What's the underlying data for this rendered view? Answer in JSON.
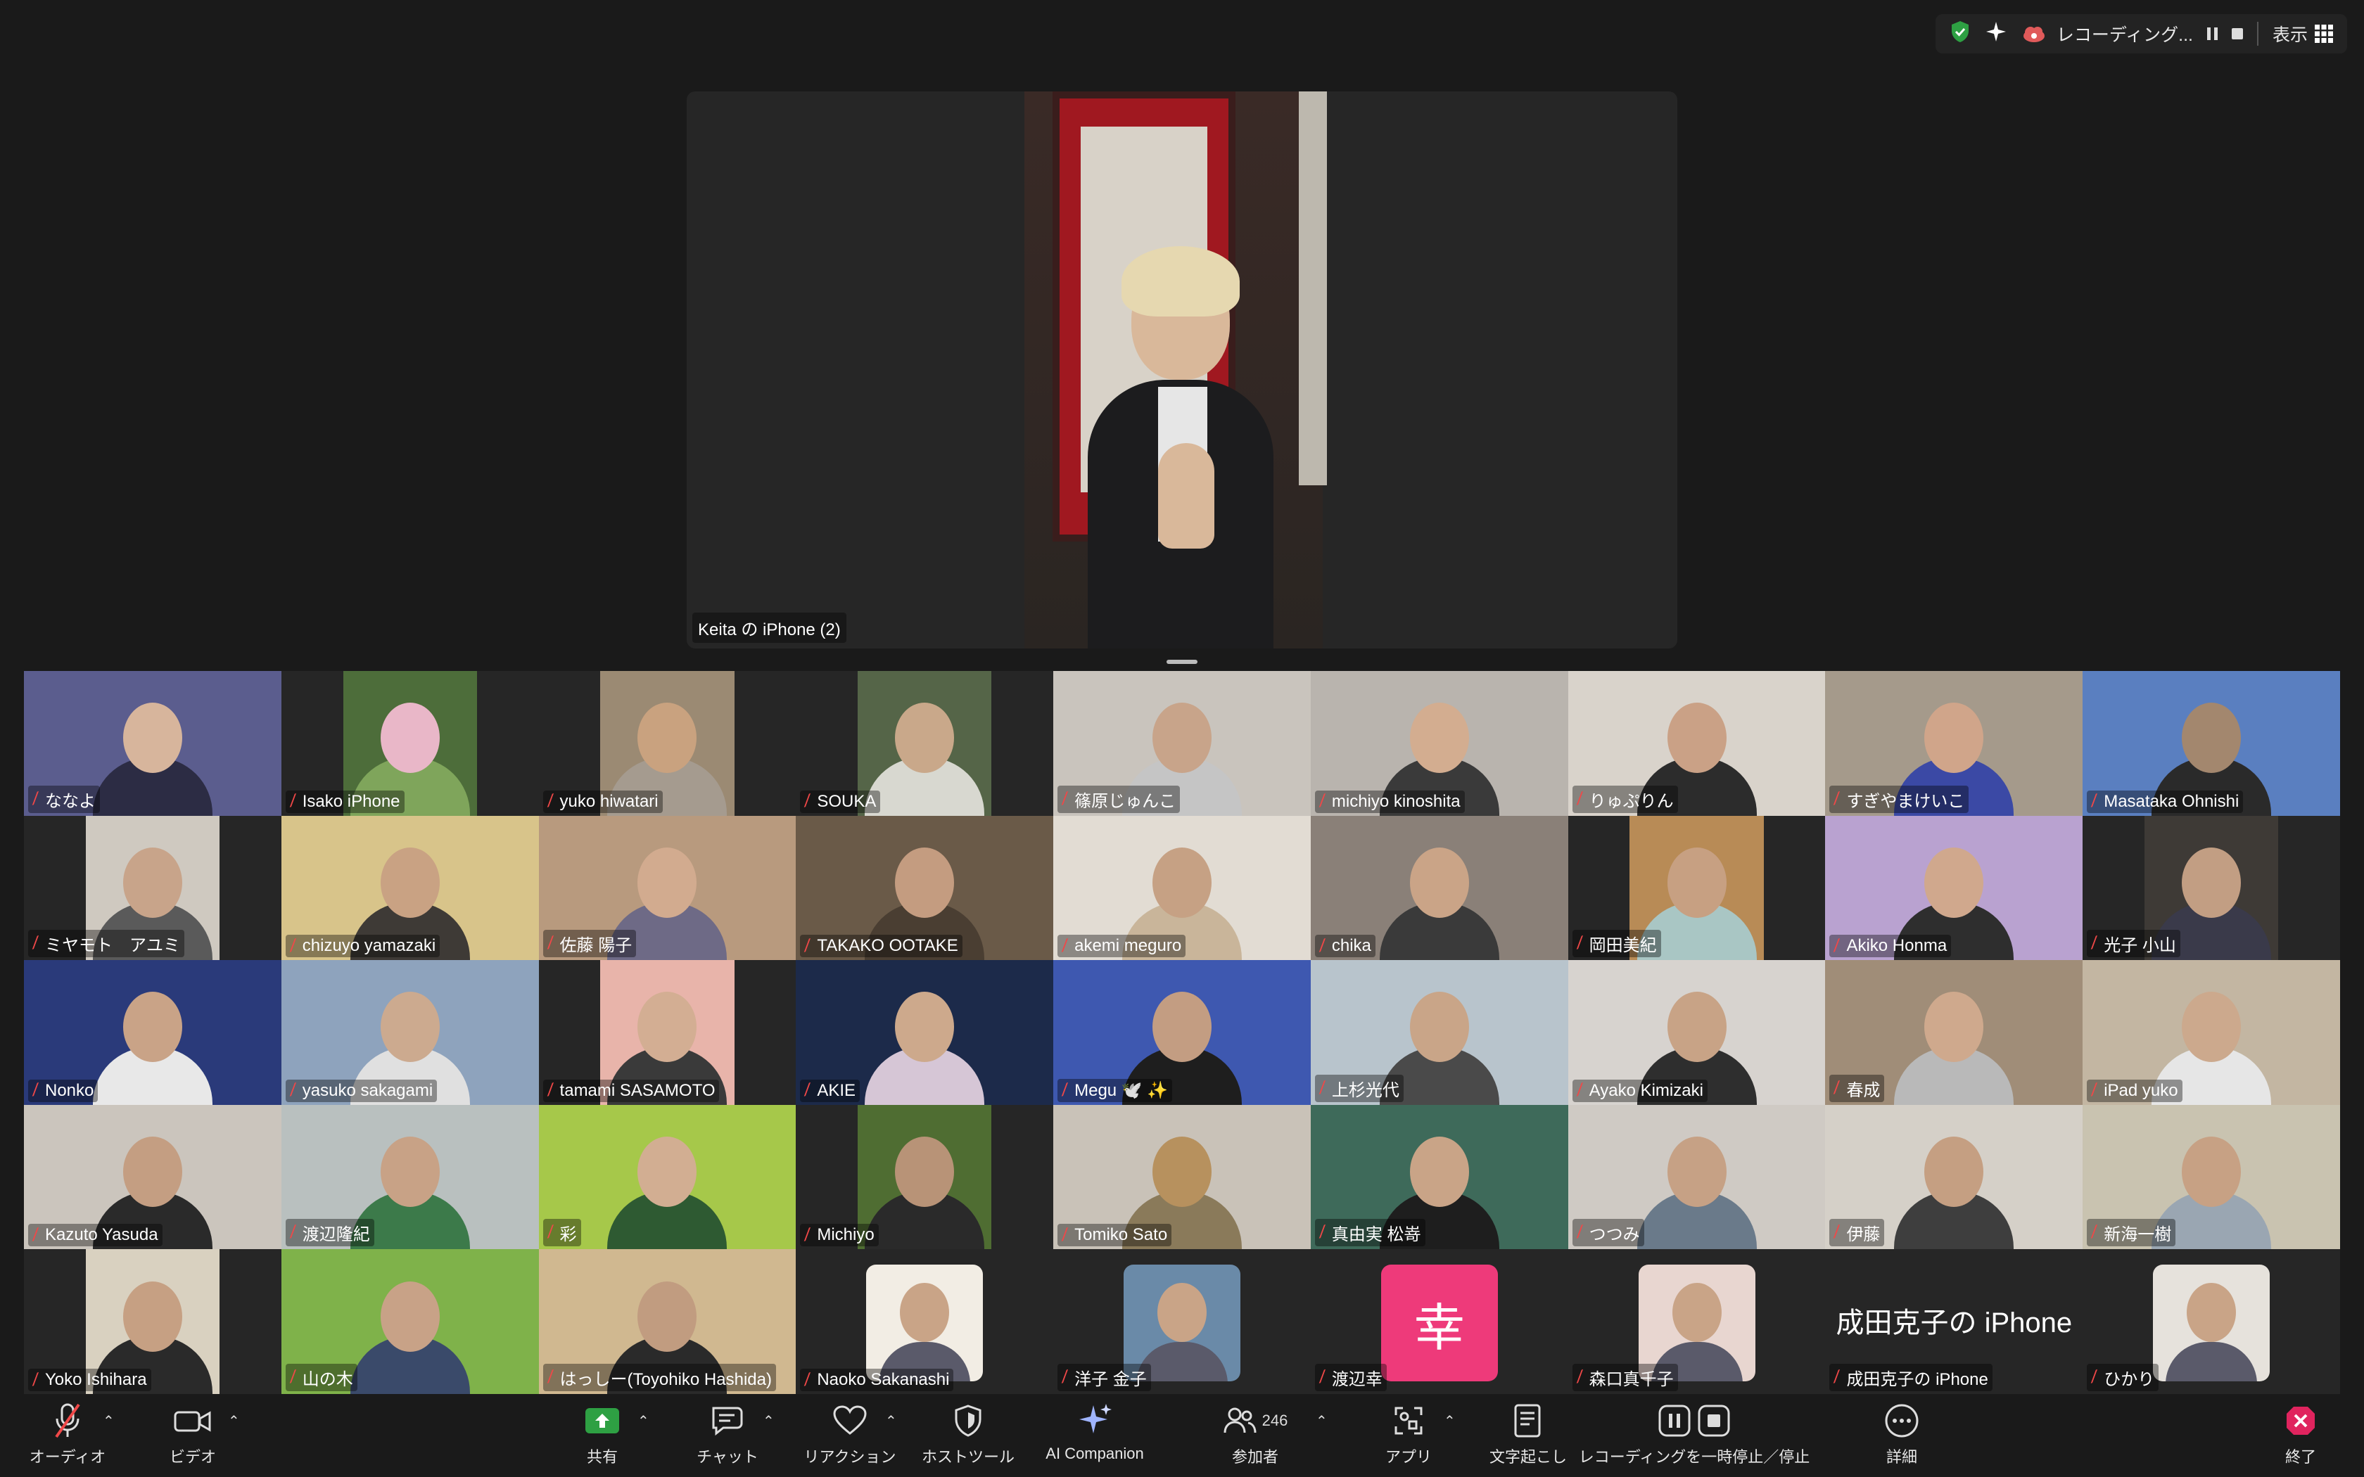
{
  "topbar": {
    "recording_label": "レコーディング...",
    "view_label": "表示",
    "colors": {
      "shield": "#2ea043",
      "recording": "#e05a5a"
    }
  },
  "speaker": {
    "name": "Keita の iPhone (2)"
  },
  "participants": [
    {
      "name": "ななよ",
      "bg": "#5b5d8e",
      "face": "#d7b59c",
      "torso": "#2c2c44"
    },
    {
      "name": "Isako iPhone",
      "bg": "#4d6d3a",
      "face": "#e9b7c8",
      "torso": "#7fa55b",
      "narrow": true
    },
    {
      "name": "yuko hiwatari",
      "bg": "#9b8a73",
      "face": "#c9a27f",
      "torso": "#a59b8f",
      "narrow": true
    },
    {
      "name": "SOUKA",
      "bg": "#556548",
      "face": "#c9a88a",
      "torso": "#d8d8d0",
      "narrow": true
    },
    {
      "name": "篠原じゅんこ",
      "bg": "#c9c4bd",
      "face": "#c8a48a",
      "torso": "#c5c5c5"
    },
    {
      "name": "michiyo kinoshita",
      "bg": "#b9b4ae",
      "face": "#d3ad90",
      "torso": "#3a3a3a"
    },
    {
      "name": "りゅぷりん",
      "bg": "#d9d3cb",
      "face": "#caa186",
      "torso": "#2c2c2c"
    },
    {
      "name": "すぎやまけいこ",
      "bg": "#a59a8b",
      "face": "#d0a58a",
      "torso": "#3b49a5"
    },
    {
      "name": "Masataka Ohnishi",
      "bg": "#5a7fc0",
      "face": "#a3876e",
      "torso": "#2a2a2a"
    },
    {
      "name": "ミヤモト　アユミ",
      "bg": "#cfc9c0",
      "face": "#c8a48a",
      "torso": "#5a5a5a",
      "narrow": true
    },
    {
      "name": "chizuyo yamazaki",
      "bg": "#d8c48a",
      "face": "#c9a283",
      "torso": "#3e3a36"
    },
    {
      "name": "佐藤 陽子",
      "bg": "#b89a7e",
      "face": "#d2ab8f",
      "torso": "#6e6a86"
    },
    {
      "name": "TAKAKO OOTAKE",
      "bg": "#6a5a48",
      "face": "#c49c80",
      "torso": "#4a3e32"
    },
    {
      "name": "akemi meguro",
      "bg": "#e2dcd3",
      "face": "#c6a184",
      "torso": "#c9b59a"
    },
    {
      "name": "chika",
      "bg": "#8a8078",
      "face": "#caa487",
      "torso": "#3a3a3a"
    },
    {
      "name": "岡田美紀",
      "bg": "#b88b56",
      "face": "#c7a082",
      "torso": "#a9c6c4",
      "narrow": true
    },
    {
      "name": "Akiko Honma",
      "bg": "#b9a2d0",
      "face": "#d0a88d",
      "torso": "#2e2e2e"
    },
    {
      "name": "光子 小山",
      "bg": "#3e3a36",
      "face": "#c29e83",
      "torso": "#3a3a4a",
      "narrow": true
    },
    {
      "name": "Nonko",
      "bg": "#2a3a7a",
      "face": "#c9a387",
      "torso": "#e8e8e8"
    },
    {
      "name": "yasuko sakagami",
      "bg": "#8ea3bd",
      "face": "#ccaa8f",
      "torso": "#e0e0e0"
    },
    {
      "name": "tamami SASAMOTO",
      "bg": "#e8b4aa",
      "face": "#d3ae93",
      "torso": "#3a3a3a",
      "narrow": true
    },
    {
      "name": "AKIE",
      "bg": "#1c2a4a",
      "face": "#cda98c",
      "torso": "#d6c6d6"
    },
    {
      "name": "Megu 🕊️ ✨",
      "bg": "#3e58b0",
      "face": "#c39d82",
      "torso": "#1e1e1e"
    },
    {
      "name": "上杉光代",
      "bg": "#b8c4cc",
      "face": "#c9a588",
      "torso": "#4a4a4a"
    },
    {
      "name": "Ayako Kimizaki",
      "bg": "#d7d3cf",
      "face": "#c8a386",
      "torso": "#2e2e2e"
    },
    {
      "name": "春成",
      "bg": "#a08d78",
      "face": "#cfa98d",
      "torso": "#b9b9b9"
    },
    {
      "name": "iPad yuko",
      "bg": "#c3b6a2",
      "face": "#cca98d",
      "torso": "#e6e6e6"
    },
    {
      "name": "Kazuto Yasuda",
      "bg": "#cbc5bd",
      "face": "#c49e82",
      "torso": "#2a2a2a"
    },
    {
      "name": "渡辺隆紀",
      "bg": "#b9c0bf",
      "face": "#c8a286",
      "torso": "#3c7a4a"
    },
    {
      "name": "彩",
      "bg": "#a6c84a",
      "face": "#d2ae92",
      "torso": "#2e5a32"
    },
    {
      "name": "Michiyo",
      "bg": "#4f6d32",
      "face": "#b89377",
      "torso": "#2a2a2a",
      "narrow": true
    },
    {
      "name": "Tomiko Sato",
      "bg": "#c9c2b8",
      "face": "#b7915e",
      "torso": "#8a7a5a"
    },
    {
      "name": "真由実 松嵜",
      "bg": "#3e6a5a",
      "face": "#c9a487",
      "torso": "#1e1e1e"
    },
    {
      "name": "つつみ",
      "bg": "#cfcac4",
      "face": "#c6a185",
      "torso": "#6a7a8a"
    },
    {
      "name": "伊藤",
      "bg": "#d5d0c8",
      "face": "#c59f82",
      "torso": "#3e3e3e"
    },
    {
      "name": "新海一樹",
      "bg": "#c9c3b0",
      "face": "#c7a184",
      "torso": "#9aa6b2"
    },
    {
      "name": "Yoko Ishihara",
      "bg": "#d9d1c0",
      "face": "#c6a083",
      "torso": "#2a2a2a",
      "narrow": true
    },
    {
      "name": "山の木",
      "bg": "#7fb24a",
      "face": "#c8a287",
      "torso": "#3a4a6a"
    },
    {
      "name": "はっしー(Toyohiko Hashida)",
      "bg": "#d0b890",
      "face": "#c19c80",
      "torso": "#2a2a2a"
    },
    {
      "name": "Naoko Sakanashi",
      "avatar": "#f2ede4"
    },
    {
      "name": "洋子 金子",
      "avatar": "#6a8aa8"
    },
    {
      "name": "渡辺幸",
      "kanji": "幸"
    },
    {
      "name": "森口真千子",
      "avatar": "#e8d6d0"
    },
    {
      "name": "成田克子の iPhone",
      "bigname": "成田克子の iPhone"
    },
    {
      "name": "ひかり",
      "avatar": "#e6e2dc"
    }
  ],
  "toolbar": {
    "audio": "オーディオ",
    "video": "ビデオ",
    "share": "共有",
    "chat": "チャット",
    "reaction": "リアクション",
    "host_tools": "ホストツール",
    "ai_companion": "AI Companion",
    "participants": "参加者",
    "participants_count": "246",
    "apps": "アプリ",
    "transcript": "文字起こし",
    "recording_control": "レコーディングを一時停止／停止",
    "more": "詳細",
    "end": "終了",
    "colors": {
      "share": "#2ea043",
      "end": "#e0245e",
      "mute": "#f04848"
    }
  }
}
